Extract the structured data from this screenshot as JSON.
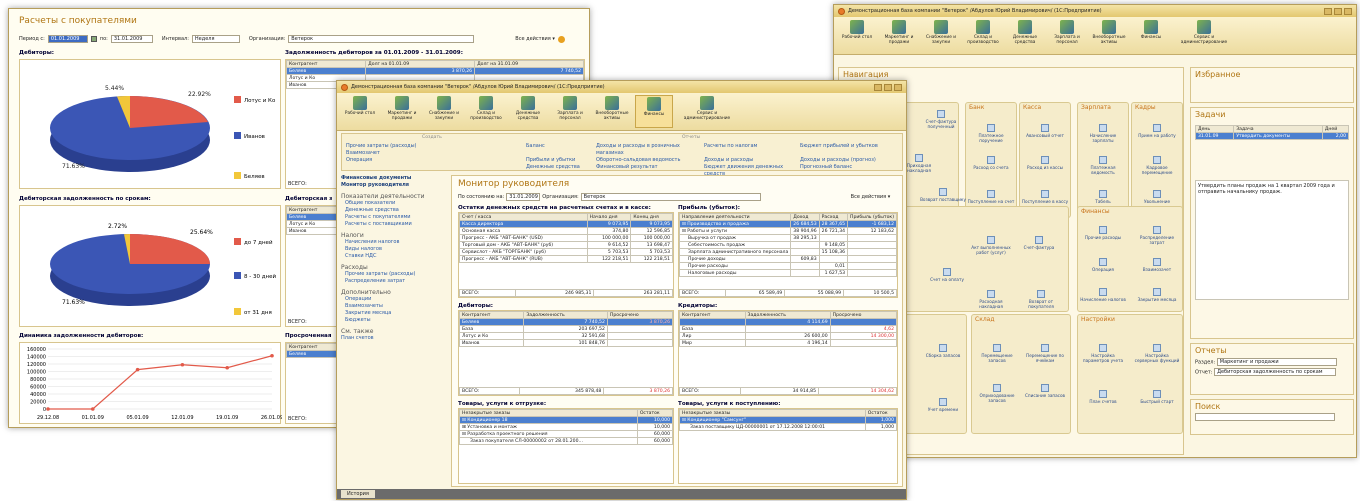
{
  "w1": {
    "title": "Расчеты с покупателями",
    "period_label": "Период с:",
    "period_from": "01.01.2009",
    "period_to_label": "по:",
    "period_to": "31.01.2009",
    "interval_label": "Интервал:",
    "interval": "Неделя",
    "org_label": "Организация:",
    "org": "Ветерок",
    "all_actions": "Все действия ▾",
    "debtors_title": "Дебиторы:",
    "debt_title": "Задолженность дебиторов за 01.01.2009 - 31.01.2009:",
    "debt_cols": [
      "Контрагент",
      "Долг на 01.01.09",
      "Долг на 31.01.09"
    ],
    "debt_rows": [
      [
        "Беляев",
        "3 870,26",
        "7 740,52"
      ],
      [
        "Лотус и Ко",
        "",
        ""
      ],
      [
        "Иванов",
        "",
        ""
      ]
    ],
    "total": "ВСЕГО:",
    "pie1": {
      "labels": [
        "5.44%",
        "22.92%",
        "71.63%"
      ],
      "legend": [
        "Лотус и Ко",
        "Иванов",
        "Беляев"
      ]
    },
    "aging_title": "Дебиторская задолженность по срокам:",
    "aging_table_title": "Дебиторская з",
    "aging_cols": [
      "Контрагент"
    ],
    "aging_rows": [
      "Беляев",
      "Лотус и Ко",
      "Иванов"
    ],
    "pie2": {
      "labels": [
        "2.72%",
        "25.64%",
        "71.63%"
      ],
      "legend": [
        "до 7 дней",
        "8 - 30 дней",
        "от 31 дня"
      ]
    },
    "dyn_title": "Динамика задолженности дебиторов:",
    "overdue_title": "Просроченная",
    "overdue_cols": [
      "Контрагент"
    ],
    "overdue_rows": [
      "Беляев"
    ]
  },
  "chart_data": {
    "type": "line",
    "x": [
      "29.12.08",
      "01.01.09",
      "05.01.09",
      "12.01.09",
      "19.01.09",
      "26.01.09"
    ],
    "values": [
      0,
      0,
      105000,
      118000,
      110000,
      142000
    ],
    "ylim": [
      0,
      160000
    ],
    "yticks": [
      "160000",
      "140000",
      "120000",
      "100000",
      "80000",
      "60000",
      "40000",
      "20000",
      "0"
    ]
  },
  "w2": {
    "title": "Демонстрационная база компании \"Ветерок\" /Абдулов Юрий Владимирович/ (1С:Предприятие)",
    "toolbar": [
      "Рабочий стол",
      "Маркетинг и продажи",
      "Снабжение и закупки",
      "Склад и производство",
      "Денежные средства",
      "Зарплата и персонал",
      "Внеоборотные активы",
      "Финансы",
      "Сервис и администрирование"
    ],
    "create_label": "Создать",
    "reports_label": "Отчеты",
    "create_items": [
      "Прочие затраты (расходы)",
      "Взаимозачет",
      "Операция"
    ],
    "report_items": [
      "Баланс",
      "Прибыли и убытки",
      "Денежные средства",
      "Доходы и расходы в розничных магазинах",
      "Оборотно-сальдовая ведомость",
      "Финансовый результат",
      "Расчеты по налогам",
      "Доходы и расходы",
      "Бюджет движения денежных средств",
      "Бюджет прибылей и убытков",
      "Доходы и расходы (прогноз)",
      "Прогнозный баланс"
    ],
    "nav": [
      "Финансовые документы",
      "Монитор руководителя",
      "Показатели деятельности",
      "Общие показатели",
      "Денежные средства",
      "Расчеты с покупателями",
      "Расчеты с поставщиками",
      "Налоги",
      "Начисления налогов",
      "Виды налогов",
      "Ставки НДС",
      "Расходы",
      "Прочие затраты (расходы)",
      "Распределение затрат",
      "Дополнительно",
      "Операции",
      "Взаимозачеты",
      "Закрытие месяца",
      "Бюджеты",
      "См. также",
      "План счетов"
    ],
    "monitor_title": "Монитор руководителя",
    "date_label": "По состоянию на:",
    "date": "31.01.2009",
    "org_label": "Организация:",
    "org": "Ветерок",
    "all_actions": "Все действия ▾",
    "cash_title": "Остатки денежных средств на расчетных счетах и в кассе:",
    "cash_cols": [
      "Счет / касса",
      "Начало дня",
      "Конец дня"
    ],
    "cash_rows": [
      [
        "Касса директора",
        "9 073,95",
        "9 073,95"
      ],
      [
        "Основная касса",
        "374,80",
        "12 596,85"
      ],
      [
        "Прогресс - АКБ \"АВТ-БАНК\" (USD)",
        "100 000,00",
        "100 000,00"
      ],
      [
        "Торговый дом - АКБ \"АВТ-БАНК\" (руб)",
        "9 614,52",
        "13 698,47"
      ],
      [
        "Сервислот - АКБ \"ТОРГБАНК\" (руб)",
        "5 703,53",
        "5 703,53"
      ],
      [
        "Прогресс - АКБ \"АВТ-БАНК\" (RUB)",
        "122 218,51",
        "122 218,51"
      ]
    ],
    "cash_total": [
      "ВСЕГО:",
      "246 985,31",
      "263 281,11"
    ],
    "profit_title": "Прибыль (убыток):",
    "profit_cols": [
      "Направление деятельности",
      "Доход",
      "Расход",
      "Прибыль (убыток)"
    ],
    "profit_rows": [
      [
        "⊟ Производство и продажа",
        "26 684,53",
        "28 367,65",
        "-1 683,12"
      ],
      [
        "⊟ Работы и услуги",
        "38 904,96",
        "26 721,34",
        "12 183,62"
      ],
      [
        "Выручка от продаж",
        "38 295,13",
        "",
        ""
      ],
      [
        "Себестоимость продаж",
        "",
        "9 148,05",
        ""
      ],
      [
        "Зарплата административного персонала",
        "",
        "15 108,36",
        ""
      ],
      [
        "Прочие доходы",
        "609,83",
        "",
        ""
      ],
      [
        "Прочие расходы",
        "",
        "0,01",
        ""
      ],
      [
        "Налоговые расходы",
        "",
        "1 627,53",
        ""
      ]
    ],
    "profit_total": [
      "ВСЕГО:",
      "65 589,49",
      "55 088,99",
      "10 500,5"
    ],
    "debtors_title": "Дебиторы:",
    "debt_cols": [
      "Контрагент",
      "Задолженность",
      "Просрочено"
    ],
    "debt_rows": [
      [
        "Беляев",
        "7 740,52",
        "3 870,26"
      ],
      [
        "База",
        "203 697,52",
        ""
      ],
      [
        "Лотус и Ко",
        "32 591,68",
        ""
      ],
      [
        "Иванов",
        "101 848,76",
        ""
      ]
    ],
    "debt_total": [
      "ВСЕГО:",
      "345 878,48",
      "3 870,26"
    ],
    "cred_title": "Кредиторы:",
    "cred_cols": [
      "Контрагент",
      "Задолженность",
      "Просрочено"
    ],
    "cred_rows": [
      [
        "",
        "4 114,69",
        ""
      ],
      [
        "База",
        "",
        "4,62"
      ],
      [
        "Лир",
        "26 600,00",
        "14 300,00"
      ],
      [
        "Мир",
        "4 196,14",
        ""
      ]
    ],
    "cred_total": [
      "ВСЕГО:",
      "34 914,85",
      "14 304,62"
    ],
    "ship_title": "Товары, услуги к отгрузке:",
    "ship_cols": [
      "Незакрытые заказы",
      "Остаток"
    ],
    "ship_rows": [
      [
        "⊟ Кондиционер 18",
        "10,000"
      ],
      [
        "⊞ Установка и монтаж",
        "10,000"
      ],
      [
        "⊟ Разработка проектного решения",
        "60,000"
      ],
      [
        "Заказ покупателя СЛ-00000002 от 28.01.200...",
        "60,000"
      ]
    ],
    "recv_title": "Товары, услуги к поступлению:",
    "recv_cols": [
      "Незакрытые заказы",
      "Остаток"
    ],
    "recv_rows": [
      [
        "⊟ Кондиционер \"Самсунг\"",
        "1,000"
      ],
      [
        "Заказ поставщику ЦД-00000001 от 17.12.2008 12:00:01",
        "1,000"
      ]
    ],
    "history": "История"
  },
  "w3": {
    "title": "Демонстрационная база компании \"Ветерок\" /Абдулов Юрий Владимирович/ (1С:Предприятие)",
    "toolbar": [
      "Рабочий стол",
      "Маркетинг и продажи",
      "Снабжение и закупки",
      "Склад и производство",
      "Денежные средства",
      "Зарплата и персонал",
      "Внеоборотные активы",
      "Финансы",
      "Сервис и администрирование"
    ],
    "nav_title": "Навигация",
    "groups": [
      "Банк",
      "Касса",
      "Зарплата",
      "Кадры",
      "Финансы",
      "Склад",
      "Настройки"
    ],
    "items": [
      "Счет-фактура полученный",
      "Приходная накладная",
      "Возврат поставщику",
      "Платежное поручение",
      "Авансовый отчет",
      "Расход со счета",
      "Расход из кассы",
      "Поступление на счет",
      "Поступление в кассу",
      "Начисление зарплаты",
      "Прием на работу",
      "Платежная ведомость",
      "Кадровое перемещение",
      "Табель",
      "Увольнение",
      "Счет на оплату",
      "Акт выполненных работ (услуг)",
      "Счет-фактура",
      "Расходная накладная",
      "Возврат от покупателя",
      "Прочие расходы",
      "Распределение затрат",
      "Операция",
      "Взаимозачет",
      "Начисление налогов",
      "Закрытие месяца",
      "Сборка запасов",
      "Перемещение запасов",
      "Перемещение по ячейкам",
      "Оприходование запасов",
      "Списание запасов",
      "Учет времени",
      "Настройка параметров учета",
      "Настройка серверных функций",
      "План счетов",
      "Быстрый старт"
    ],
    "fav_title": "Избранное",
    "tasks_title": "Задачи",
    "task_cols": [
      "День",
      "Задача",
      "Дней"
    ],
    "task_row": [
      "31.01.09",
      "Утвердить документы",
      "2,00"
    ],
    "task_text": "Утвердить планы продаж на 1 квартал 2009 года и отправить начальнику продаж.",
    "reports_title": "Отчеты",
    "section_label": "Раздел:",
    "section": "Маркетинг и продажи",
    "report_label": "Отчет:",
    "report": "Дебиторская задолженность по срокам",
    "search_title": "Поиск"
  }
}
